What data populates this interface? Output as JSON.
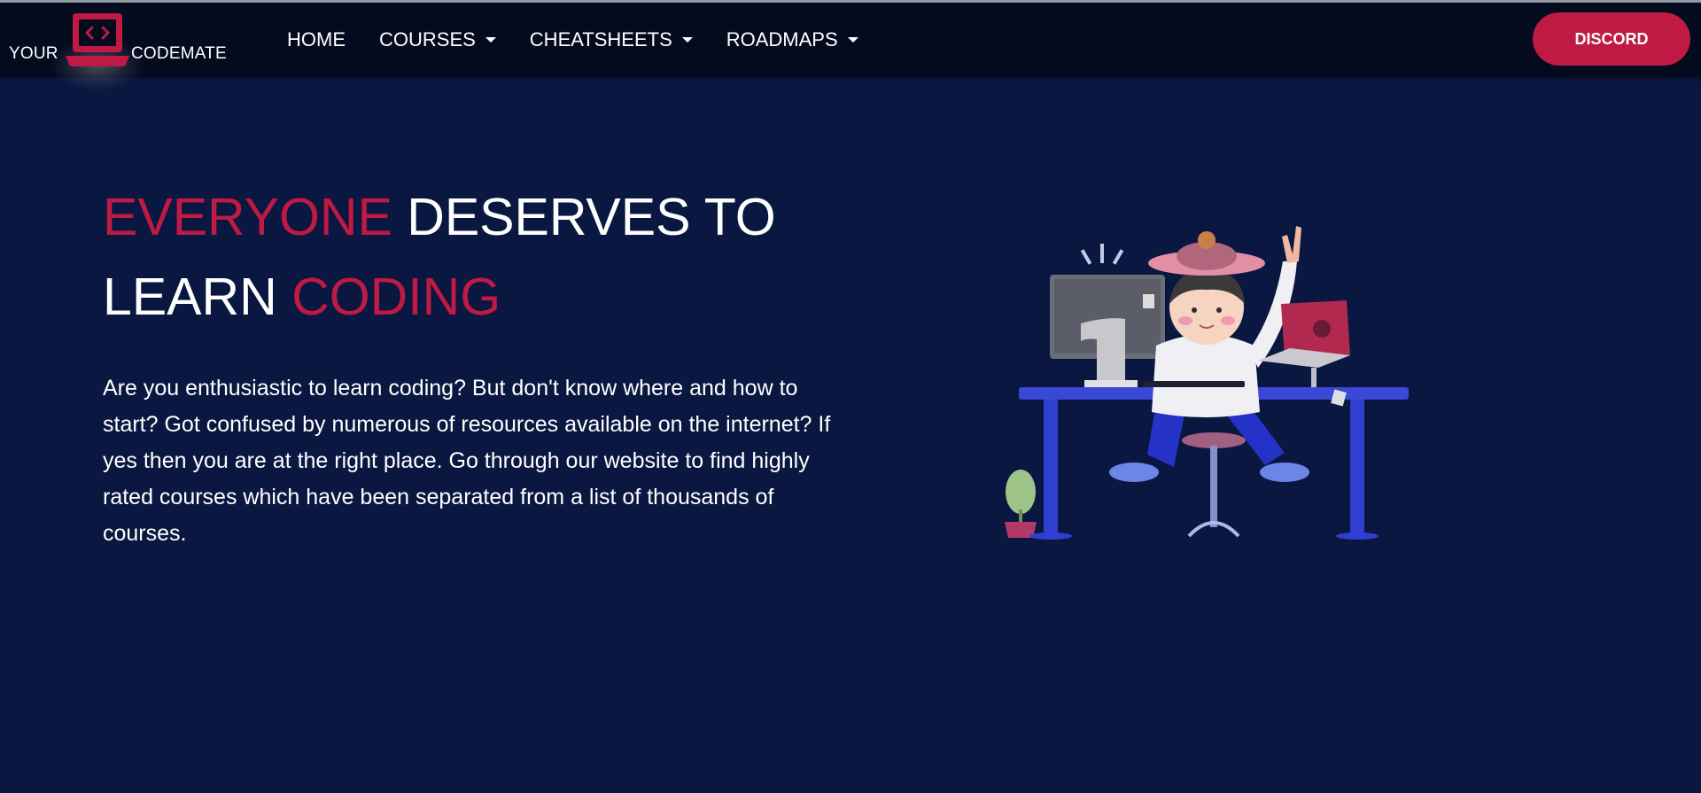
{
  "navbar": {
    "brand": {
      "left_text": "YOUR",
      "right_text": "CODEMATE",
      "logo_icon": "laptop-code-icon"
    },
    "links": [
      {
        "label": "HOME",
        "has_dropdown": false
      },
      {
        "label": "COURSES",
        "has_dropdown": true
      },
      {
        "label": "CHEATSHEETS",
        "has_dropdown": true
      },
      {
        "label": "ROADMAPS",
        "has_dropdown": true
      }
    ],
    "discord_label": "DISCORD"
  },
  "hero": {
    "title": {
      "part1": "EVERYONE",
      "part2": " DESERVES TO",
      "part3": "LEARN ",
      "part4": "CODING"
    },
    "description": "Are you enthusiastic to learn coding? But don't know where and how to start? Got confused by numerous of resources available on the internet? If yes then you are at the right place. Go through our website to find highly rated courses which have been separated from a list of thousands of courses."
  },
  "colors": {
    "background": "#0a1740",
    "navbar": "#040b1f",
    "accent": "#be1a44",
    "text": "#ffffff"
  }
}
